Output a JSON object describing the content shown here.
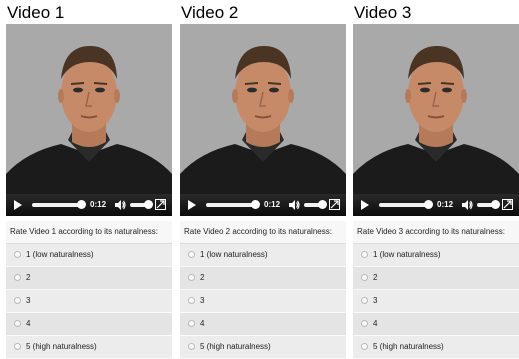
{
  "videos": [
    {
      "title": "Video 1",
      "time": "0:12",
      "prompt": "Rate Video 1 according to its naturalness:",
      "options": [
        "1 (low naturalness)",
        "2",
        "3",
        "4",
        "5 (high naturalness)"
      ]
    },
    {
      "title": "Video 2",
      "time": "0:12",
      "prompt": "Rate Video 2 according to its naturalness:",
      "options": [
        "1 (low naturalness)",
        "2",
        "3",
        "4",
        "5 (high naturalness)"
      ]
    },
    {
      "title": "Video 3",
      "time": "0:12",
      "prompt": "Rate Video 3 according to its naturalness:",
      "options": [
        "1 (low naturalness)",
        "2",
        "3",
        "4",
        "5 (high naturalness)"
      ]
    }
  ],
  "icons": {
    "play": "play-icon",
    "volume": "volume-icon",
    "fullscreen": "fullscreen-icon",
    "radio": "radio-unselected"
  },
  "colors": {
    "video_background": "#a8a8a8",
    "control_bar": "#111111",
    "rating_panel": "#ececec"
  }
}
